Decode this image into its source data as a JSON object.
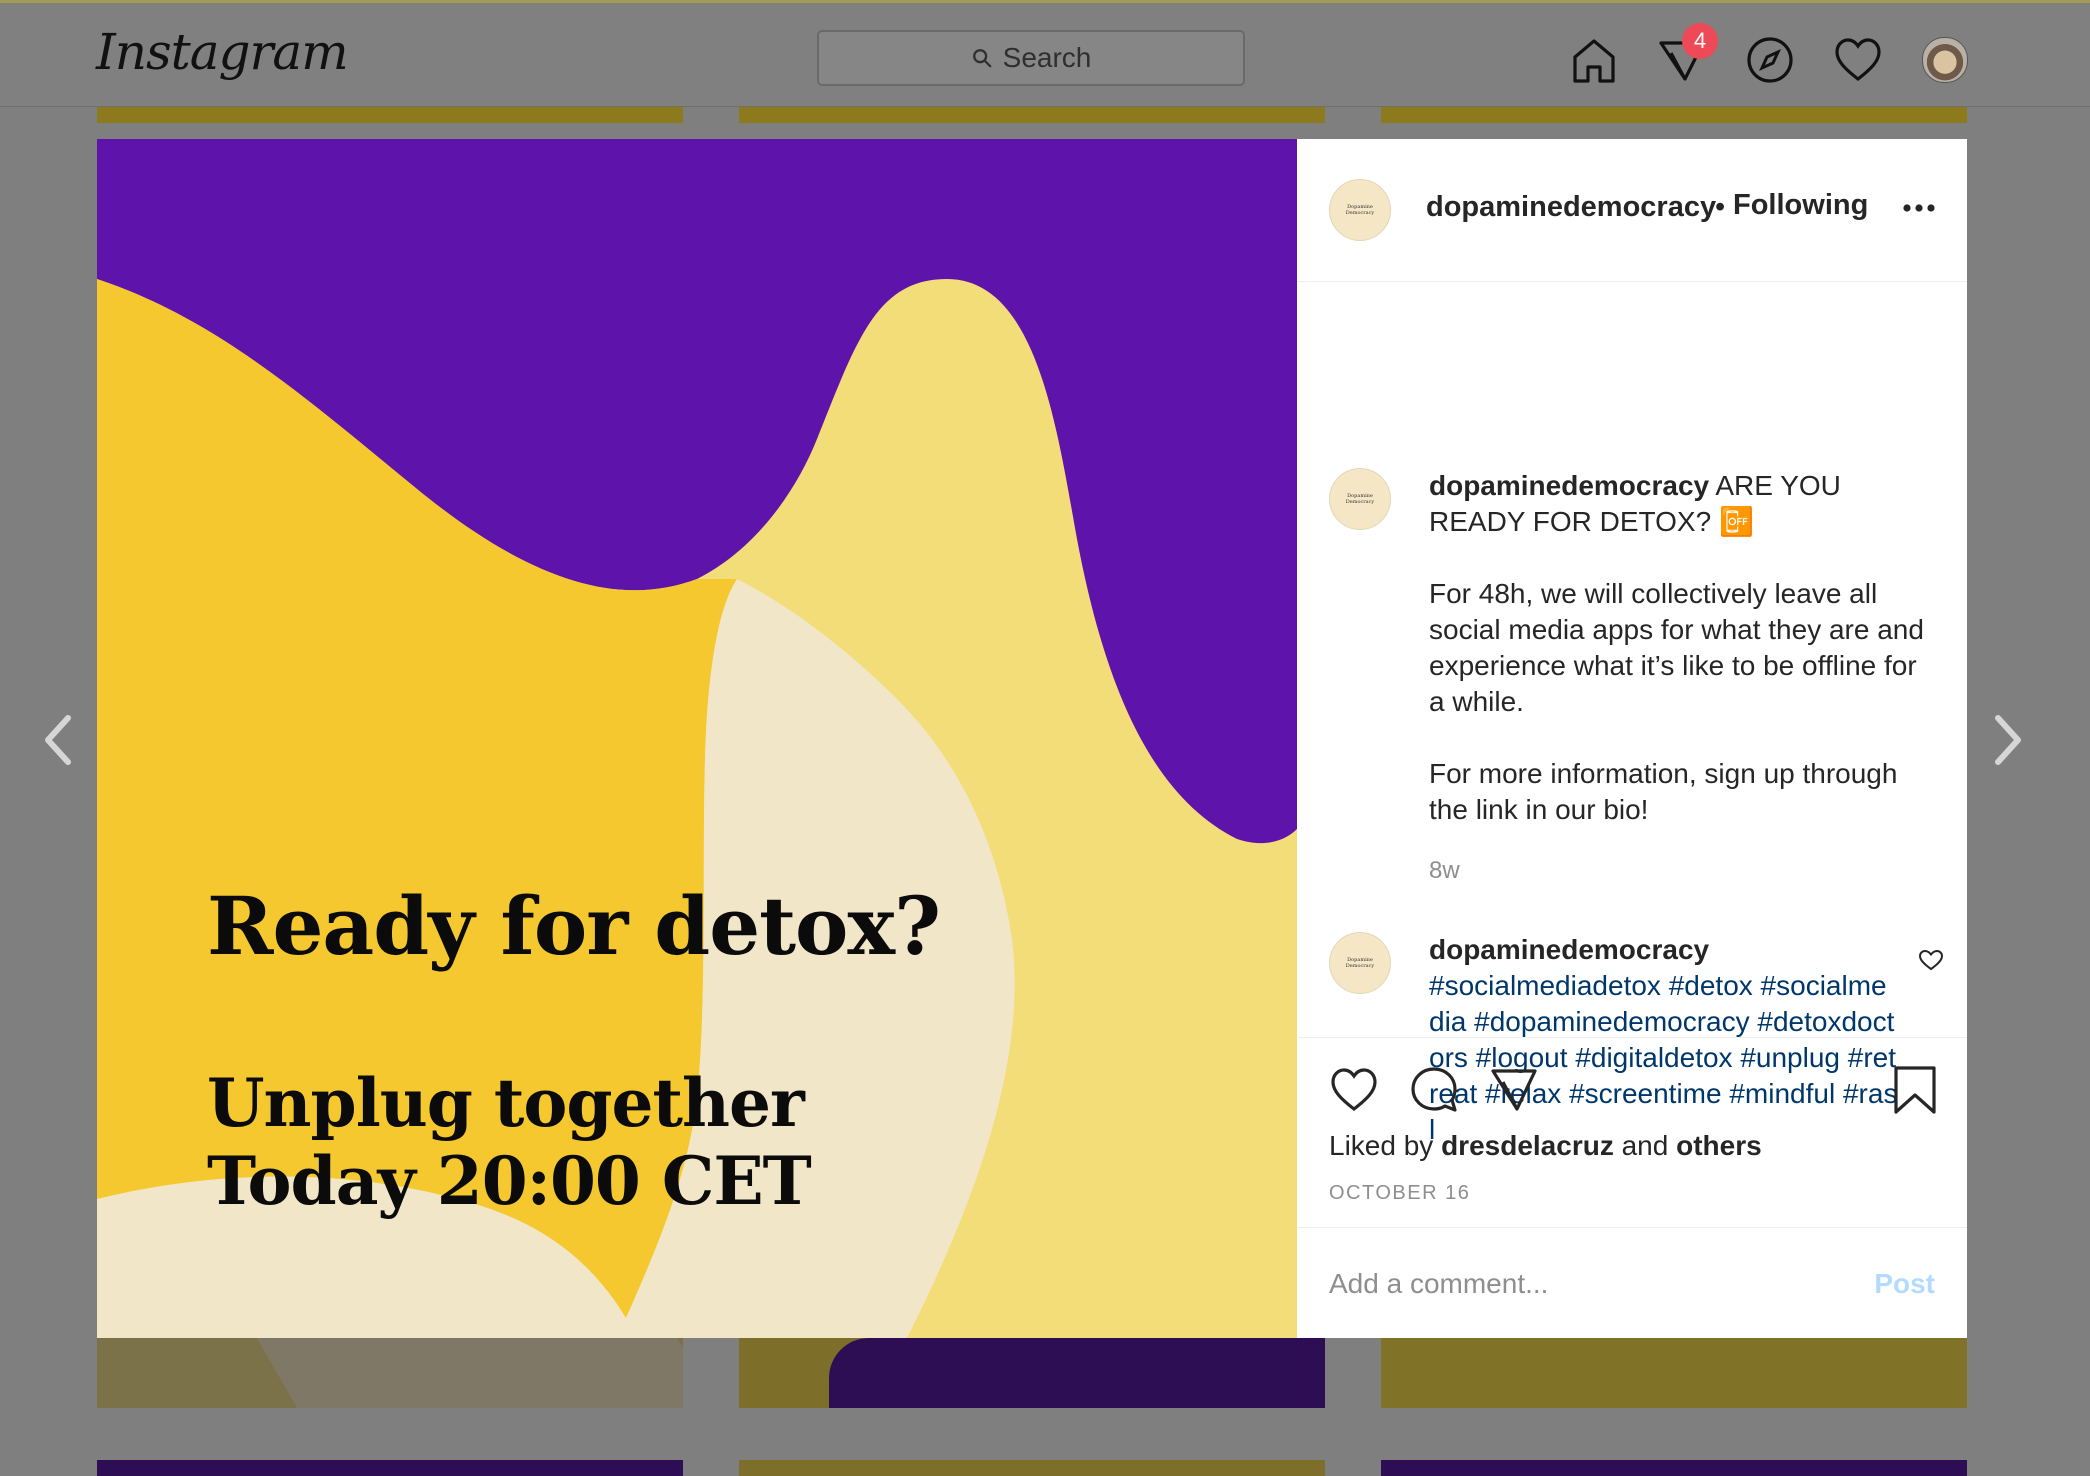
{
  "app": {
    "logo": "Instagram",
    "search_placeholder": "Search",
    "notification_count": "4"
  },
  "post": {
    "image_text": {
      "title": "Ready for detox?",
      "line1": "Unplug together",
      "line2": "Today 20:00 CET"
    },
    "username": "dopaminedemocracy",
    "avatar_text": [
      "Dopamine",
      "Democracy"
    ],
    "separator": "•",
    "follow_state": "Following",
    "caption": {
      "username": "dopaminedemocracy",
      "headline": "ARE YOU READY FOR DETOX?",
      "emoji": "📴",
      "paragraph1": "For 48h, we will collectively leave all social media apps for what they are and experience what it’s like to be offline for a while.",
      "paragraph2": "For more information, sign up through the link in our bio!",
      "time": "8w"
    },
    "comment": {
      "username": "dopaminedemocracy",
      "text": "#socialmediadetox #detox #socialmedia #dopaminedemocracy #detoxdoctors #logout #digitaldetox #unplug #retreat #relax #screentime #mindful #rasl"
    },
    "likes": {
      "prefix": "Liked by",
      "user": "dresdelacruz",
      "conj": "and",
      "others": "others"
    },
    "date": "OCTOBER 16",
    "add_comment_placeholder": "Add a comment...",
    "post_label": "Post"
  },
  "colors": {
    "purple": "#5e14ab",
    "yellow": "#f4c82e",
    "light_yellow": "#f2dd78",
    "cream": "#f1e7c8",
    "link": "#00376b",
    "post_disabled": "#b3dbff",
    "badge": "#ed4956"
  },
  "icons": [
    "search-icon",
    "home-icon",
    "direct-icon",
    "explore-icon",
    "activity-heart-icon",
    "more-options-icon",
    "like-icon",
    "comment-icon",
    "share-icon",
    "bookmark-icon",
    "chevron-left-icon",
    "chevron-right-icon"
  ]
}
